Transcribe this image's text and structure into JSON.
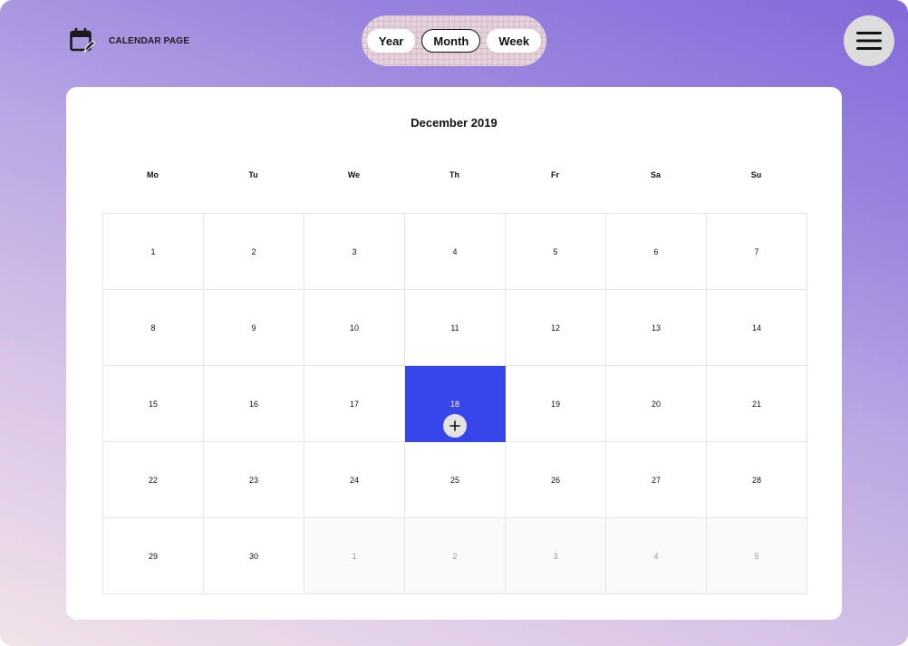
{
  "header": {
    "title": "CALENDAR PAGE",
    "view_options": [
      "Year",
      "Month",
      "Week"
    ],
    "active_view": "Month"
  },
  "calendar": {
    "month_title": "December 2019",
    "weekdays": [
      "Mo",
      "Tu",
      "We",
      "Th",
      "Fr",
      "Sa",
      "Su"
    ],
    "weeks": [
      [
        {
          "day": "1"
        },
        {
          "day": "2"
        },
        {
          "day": "3"
        },
        {
          "day": "4"
        },
        {
          "day": "5"
        },
        {
          "day": "6"
        },
        {
          "day": "7"
        }
      ],
      [
        {
          "day": "8"
        },
        {
          "day": "9"
        },
        {
          "day": "10"
        },
        {
          "day": "11"
        },
        {
          "day": "12"
        },
        {
          "day": "13"
        },
        {
          "day": "14"
        }
      ],
      [
        {
          "day": "15"
        },
        {
          "day": "16"
        },
        {
          "day": "17"
        },
        {
          "day": "18",
          "selected": true
        },
        {
          "day": "19"
        },
        {
          "day": "20"
        },
        {
          "day": "21"
        }
      ],
      [
        {
          "day": "22"
        },
        {
          "day": "23"
        },
        {
          "day": "24"
        },
        {
          "day": "25"
        },
        {
          "day": "26"
        },
        {
          "day": "27"
        },
        {
          "day": "28"
        }
      ],
      [
        {
          "day": "29"
        },
        {
          "day": "30"
        },
        {
          "day": "1",
          "muted": true
        },
        {
          "day": "2",
          "muted": true
        },
        {
          "day": "3",
          "muted": true
        },
        {
          "day": "4",
          "muted": true
        },
        {
          "day": "5",
          "muted": true
        }
      ]
    ]
  },
  "icons": {
    "brand": "calendar-edit-icon",
    "menu": "hamburger-menu-icon",
    "add": "plus-icon"
  },
  "colors": {
    "selected_day": "#3646eb",
    "gradient_start": "#f1e3e9",
    "gradient_end": "#8468d9"
  }
}
